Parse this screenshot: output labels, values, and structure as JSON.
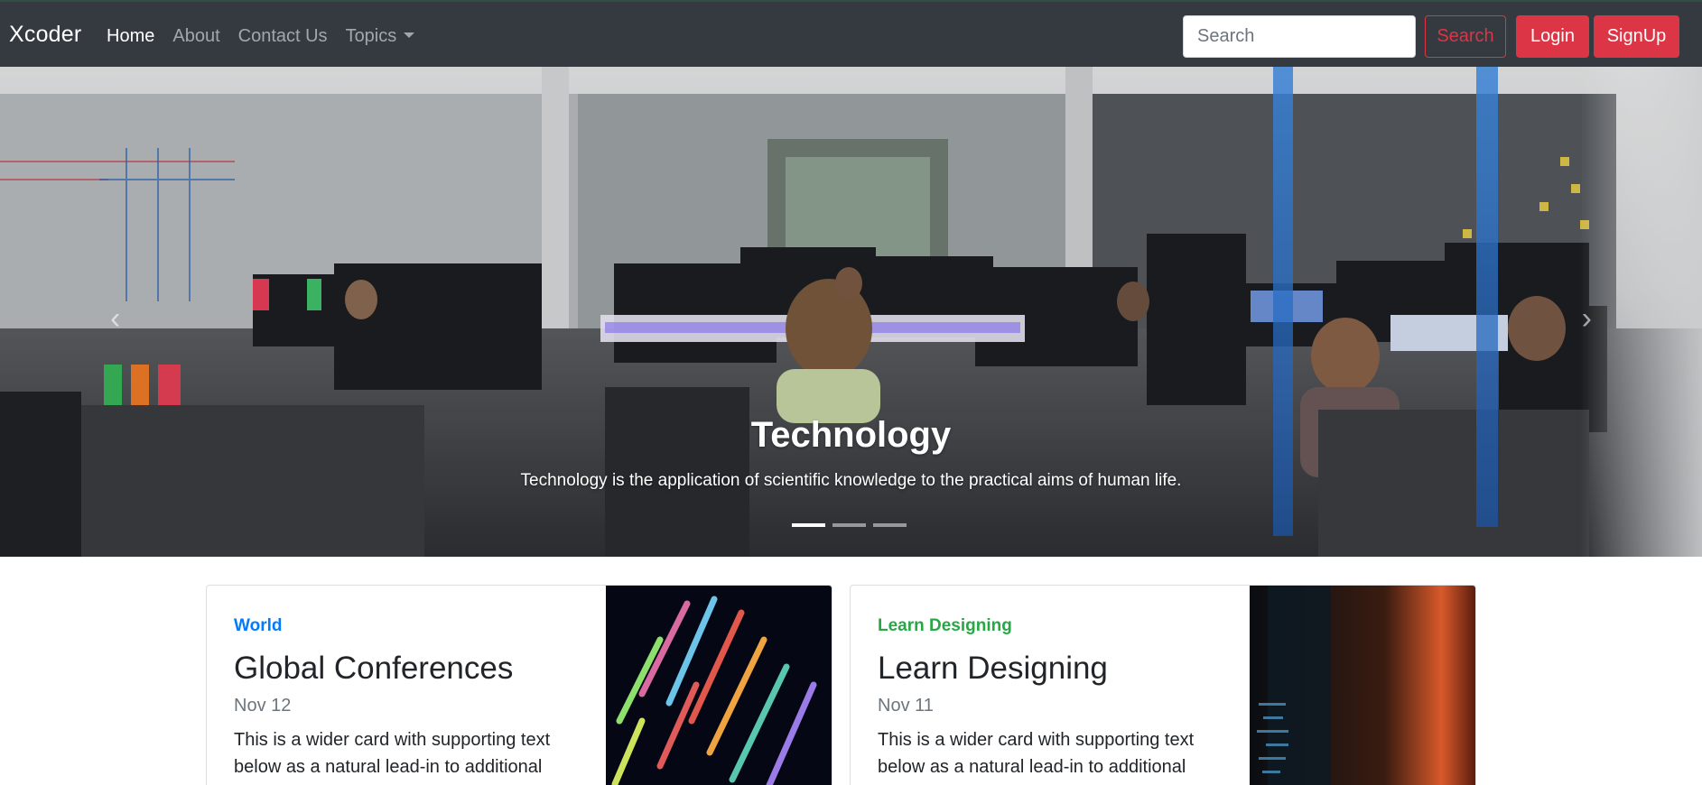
{
  "navbar": {
    "brand": "Xcoder",
    "links": [
      {
        "label": "Home",
        "active": true
      },
      {
        "label": "About",
        "active": false
      },
      {
        "label": "Contact Us",
        "active": false
      },
      {
        "label": "Topics",
        "active": false
      }
    ],
    "search_placeholder": "Search",
    "search_button": "Search",
    "login_button": "Login",
    "signup_button": "SignUp"
  },
  "carousel": {
    "title": "Technology",
    "text": "Technology is the application of scientific knowledge to the practical aims of human life.",
    "slides": 3,
    "active_slide": 1
  },
  "cards": [
    {
      "category": "World",
      "title": "Global Conferences",
      "date": "Nov 12",
      "text": "This is a wider card with supporting text below as a natural lead-in to additional content."
    },
    {
      "category": "Learn Designing",
      "title": "Learn Designing",
      "date": "Nov 11",
      "text": "This is a wider card with supporting text below as a natural lead-in to additional content."
    }
  ],
  "colors": {
    "navbar": "#343a40",
    "danger": "#dc3545",
    "primary": "#007bff",
    "success": "#28a745"
  }
}
